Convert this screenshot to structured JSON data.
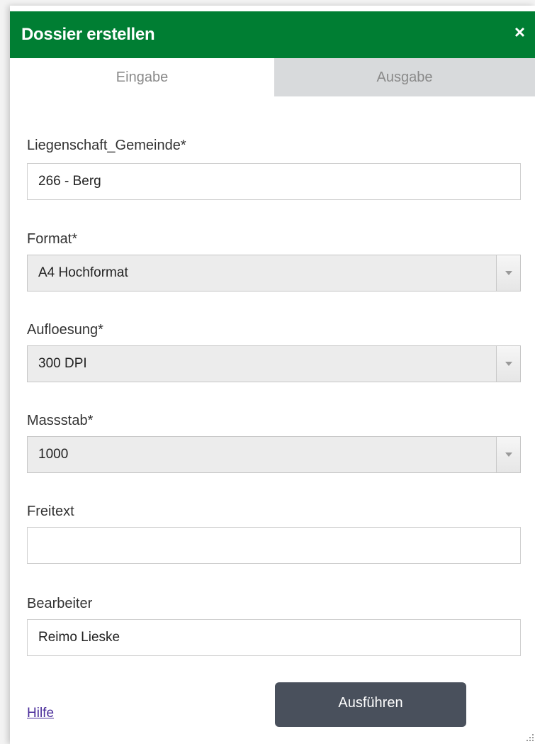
{
  "dialog": {
    "title": "Dossier erstellen",
    "close_symbol": "×",
    "close_icon": "close-icon",
    "title_color": "#007e33"
  },
  "tabs": [
    {
      "label": "Eingabe",
      "active": true
    },
    {
      "label": "Ausgabe",
      "active": false
    }
  ],
  "fields": {
    "gemeinde": {
      "label": "Liegenschaft_Gemeinde*",
      "value": "266 - Berg"
    },
    "format": {
      "label": "Format*",
      "value": "A4 Hochformat"
    },
    "aufloesung": {
      "label": "Aufloesung*",
      "value": "300 DPI"
    },
    "massstab": {
      "label": "Massstab*",
      "value": "1000"
    },
    "freitext": {
      "label": "Freitext",
      "value": ""
    },
    "bearbeiter": {
      "label": "Bearbeiter",
      "value": "Reimo Lieske"
    }
  },
  "footer": {
    "help_label": "Hilfe",
    "run_label": "Ausführen",
    "run_button_color": "#49505c"
  },
  "icons": {
    "dropdown": "chevron-down-icon",
    "resize": "resize-grip-icon"
  }
}
